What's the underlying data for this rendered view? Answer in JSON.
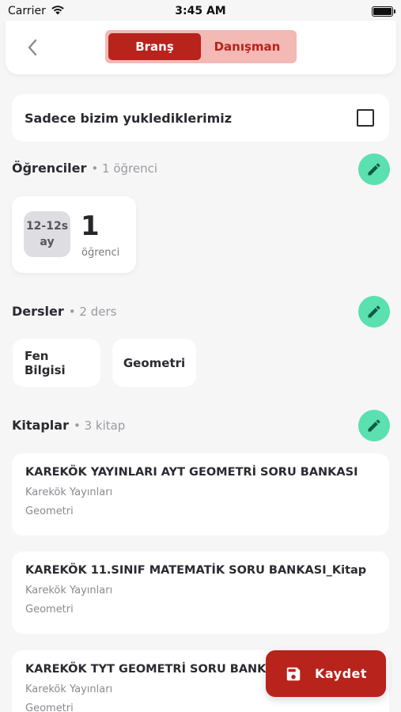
{
  "status_bar": {
    "carrier": "Carrier",
    "time": "3:45 AM"
  },
  "header": {
    "back_icon": "chevron-left-icon",
    "tabs": [
      {
        "label": "Branş",
        "active": true
      },
      {
        "label": "Danışman",
        "active": false
      }
    ]
  },
  "filter": {
    "label": "Sadece bizim yuklediklerimiz",
    "checked": false
  },
  "students": {
    "title": "Öğrenciler",
    "count": "• 1 öğrenci",
    "card": {
      "age_line1": "12-12s",
      "age_line2": "ay",
      "count": "1",
      "unit": "öğrenci"
    }
  },
  "lessons": {
    "title": "Dersler",
    "count": "• 2 ders",
    "items": [
      "Fen Bilgisi",
      "Geometri"
    ]
  },
  "books": {
    "title": "Kitaplar",
    "count": "• 3 kitap",
    "items": [
      {
        "title": "KAREKÖK YAYINLARI AYT GEOMETRİ SORU BANKASI",
        "publisher": "Karekök Yayınları",
        "category": "Geometri"
      },
      {
        "title": "KAREKÖK 11.SINIF MATEMATİK SORU BANKASI_Kitap",
        "publisher": "Karekök Yayınları",
        "category": "Geometri"
      },
      {
        "title": "KAREKÖK TYT GEOMETRİ SORU BANKASI",
        "publisher": "Karekök Yayınları",
        "category": "Geometri"
      }
    ]
  },
  "save_button": {
    "label": "Kaydet",
    "icon": "save-icon"
  },
  "colors": {
    "primary": "#b8231b",
    "primary_light": "#f2b9b5",
    "edit": "#5be0b0",
    "background": "#f6f6f7"
  }
}
